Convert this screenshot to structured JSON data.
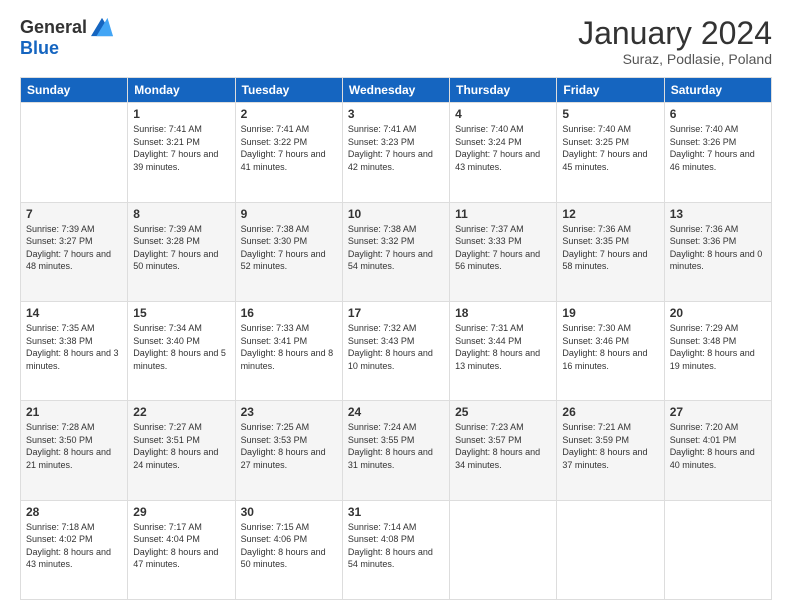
{
  "logo": {
    "general": "General",
    "blue": "Blue"
  },
  "header": {
    "month": "January 2024",
    "location": "Suraz, Podlasie, Poland"
  },
  "days": [
    "Sunday",
    "Monday",
    "Tuesday",
    "Wednesday",
    "Thursday",
    "Friday",
    "Saturday"
  ],
  "weeks": [
    [
      {
        "day": "",
        "sunrise": "",
        "sunset": "",
        "daylight": ""
      },
      {
        "day": "1",
        "sunrise": "Sunrise: 7:41 AM",
        "sunset": "Sunset: 3:21 PM",
        "daylight": "Daylight: 7 hours and 39 minutes."
      },
      {
        "day": "2",
        "sunrise": "Sunrise: 7:41 AM",
        "sunset": "Sunset: 3:22 PM",
        "daylight": "Daylight: 7 hours and 41 minutes."
      },
      {
        "day": "3",
        "sunrise": "Sunrise: 7:41 AM",
        "sunset": "Sunset: 3:23 PM",
        "daylight": "Daylight: 7 hours and 42 minutes."
      },
      {
        "day": "4",
        "sunrise": "Sunrise: 7:40 AM",
        "sunset": "Sunset: 3:24 PM",
        "daylight": "Daylight: 7 hours and 43 minutes."
      },
      {
        "day": "5",
        "sunrise": "Sunrise: 7:40 AM",
        "sunset": "Sunset: 3:25 PM",
        "daylight": "Daylight: 7 hours and 45 minutes."
      },
      {
        "day": "6",
        "sunrise": "Sunrise: 7:40 AM",
        "sunset": "Sunset: 3:26 PM",
        "daylight": "Daylight: 7 hours and 46 minutes."
      }
    ],
    [
      {
        "day": "7",
        "sunrise": "Sunrise: 7:39 AM",
        "sunset": "Sunset: 3:27 PM",
        "daylight": "Daylight: 7 hours and 48 minutes."
      },
      {
        "day": "8",
        "sunrise": "Sunrise: 7:39 AM",
        "sunset": "Sunset: 3:28 PM",
        "daylight": "Daylight: 7 hours and 50 minutes."
      },
      {
        "day": "9",
        "sunrise": "Sunrise: 7:38 AM",
        "sunset": "Sunset: 3:30 PM",
        "daylight": "Daylight: 7 hours and 52 minutes."
      },
      {
        "day": "10",
        "sunrise": "Sunrise: 7:38 AM",
        "sunset": "Sunset: 3:32 PM",
        "daylight": "Daylight: 7 hours and 54 minutes."
      },
      {
        "day": "11",
        "sunrise": "Sunrise: 7:37 AM",
        "sunset": "Sunset: 3:33 PM",
        "daylight": "Daylight: 7 hours and 56 minutes."
      },
      {
        "day": "12",
        "sunrise": "Sunrise: 7:36 AM",
        "sunset": "Sunset: 3:35 PM",
        "daylight": "Daylight: 7 hours and 58 minutes."
      },
      {
        "day": "13",
        "sunrise": "Sunrise: 7:36 AM",
        "sunset": "Sunset: 3:36 PM",
        "daylight": "Daylight: 8 hours and 0 minutes."
      }
    ],
    [
      {
        "day": "14",
        "sunrise": "Sunrise: 7:35 AM",
        "sunset": "Sunset: 3:38 PM",
        "daylight": "Daylight: 8 hours and 3 minutes."
      },
      {
        "day": "15",
        "sunrise": "Sunrise: 7:34 AM",
        "sunset": "Sunset: 3:40 PM",
        "daylight": "Daylight: 8 hours and 5 minutes."
      },
      {
        "day": "16",
        "sunrise": "Sunrise: 7:33 AM",
        "sunset": "Sunset: 3:41 PM",
        "daylight": "Daylight: 8 hours and 8 minutes."
      },
      {
        "day": "17",
        "sunrise": "Sunrise: 7:32 AM",
        "sunset": "Sunset: 3:43 PM",
        "daylight": "Daylight: 8 hours and 10 minutes."
      },
      {
        "day": "18",
        "sunrise": "Sunrise: 7:31 AM",
        "sunset": "Sunset: 3:44 PM",
        "daylight": "Daylight: 8 hours and 13 minutes."
      },
      {
        "day": "19",
        "sunrise": "Sunrise: 7:30 AM",
        "sunset": "Sunset: 3:46 PM",
        "daylight": "Daylight: 8 hours and 16 minutes."
      },
      {
        "day": "20",
        "sunrise": "Sunrise: 7:29 AM",
        "sunset": "Sunset: 3:48 PM",
        "daylight": "Daylight: 8 hours and 19 minutes."
      }
    ],
    [
      {
        "day": "21",
        "sunrise": "Sunrise: 7:28 AM",
        "sunset": "Sunset: 3:50 PM",
        "daylight": "Daylight: 8 hours and 21 minutes."
      },
      {
        "day": "22",
        "sunrise": "Sunrise: 7:27 AM",
        "sunset": "Sunset: 3:51 PM",
        "daylight": "Daylight: 8 hours and 24 minutes."
      },
      {
        "day": "23",
        "sunrise": "Sunrise: 7:25 AM",
        "sunset": "Sunset: 3:53 PM",
        "daylight": "Daylight: 8 hours and 27 minutes."
      },
      {
        "day": "24",
        "sunrise": "Sunrise: 7:24 AM",
        "sunset": "Sunset: 3:55 PM",
        "daylight": "Daylight: 8 hours and 31 minutes."
      },
      {
        "day": "25",
        "sunrise": "Sunrise: 7:23 AM",
        "sunset": "Sunset: 3:57 PM",
        "daylight": "Daylight: 8 hours and 34 minutes."
      },
      {
        "day": "26",
        "sunrise": "Sunrise: 7:21 AM",
        "sunset": "Sunset: 3:59 PM",
        "daylight": "Daylight: 8 hours and 37 minutes."
      },
      {
        "day": "27",
        "sunrise": "Sunrise: 7:20 AM",
        "sunset": "Sunset: 4:01 PM",
        "daylight": "Daylight: 8 hours and 40 minutes."
      }
    ],
    [
      {
        "day": "28",
        "sunrise": "Sunrise: 7:18 AM",
        "sunset": "Sunset: 4:02 PM",
        "daylight": "Daylight: 8 hours and 43 minutes."
      },
      {
        "day": "29",
        "sunrise": "Sunrise: 7:17 AM",
        "sunset": "Sunset: 4:04 PM",
        "daylight": "Daylight: 8 hours and 47 minutes."
      },
      {
        "day": "30",
        "sunrise": "Sunrise: 7:15 AM",
        "sunset": "Sunset: 4:06 PM",
        "daylight": "Daylight: 8 hours and 50 minutes."
      },
      {
        "day": "31",
        "sunrise": "Sunrise: 7:14 AM",
        "sunset": "Sunset: 4:08 PM",
        "daylight": "Daylight: 8 hours and 54 minutes."
      },
      {
        "day": "",
        "sunrise": "",
        "sunset": "",
        "daylight": ""
      },
      {
        "day": "",
        "sunrise": "",
        "sunset": "",
        "daylight": ""
      },
      {
        "day": "",
        "sunrise": "",
        "sunset": "",
        "daylight": ""
      }
    ]
  ]
}
